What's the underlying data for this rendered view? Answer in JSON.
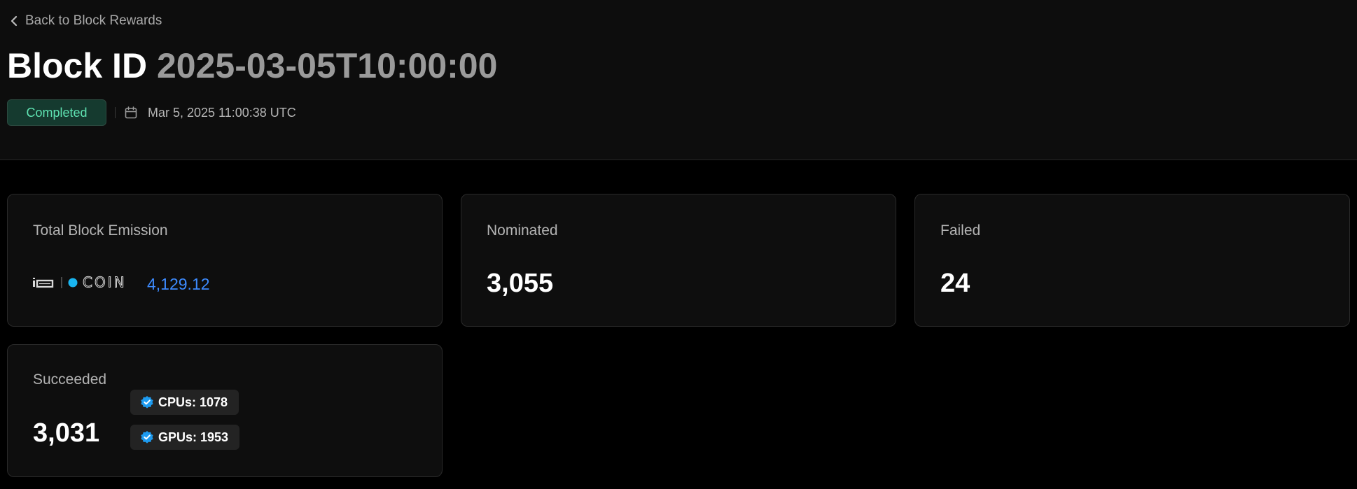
{
  "nav": {
    "back_label": "Back to Block Rewards"
  },
  "header": {
    "title_prefix": "Block ID",
    "block_id": "2025-03-05T10:00:00",
    "status": "Completed",
    "timestamp": "Mar 5, 2025 11:00:38 UTC"
  },
  "cards": {
    "emission": {
      "label": "Total Block Emission",
      "coin_name": "io.net IO coin",
      "value": "4,129.12"
    },
    "nominated": {
      "label": "Nominated",
      "value": "3,055"
    },
    "failed": {
      "label": "Failed",
      "value": "24"
    },
    "succeeded": {
      "label": "Succeeded",
      "value": "3,031",
      "cpus": "CPUs: 1078",
      "gpus": "GPUs: 1953"
    }
  },
  "colors": {
    "accent_blue": "#3d8bff",
    "status_green": "#5fe3b2",
    "status_bg": "#153a2f",
    "verified_blue": "#1d9bf0"
  },
  "icons": {
    "back": "chevron-left-icon",
    "date": "calendar-icon",
    "verified": "verified-badge-icon",
    "coin": "io-coin-logo"
  }
}
